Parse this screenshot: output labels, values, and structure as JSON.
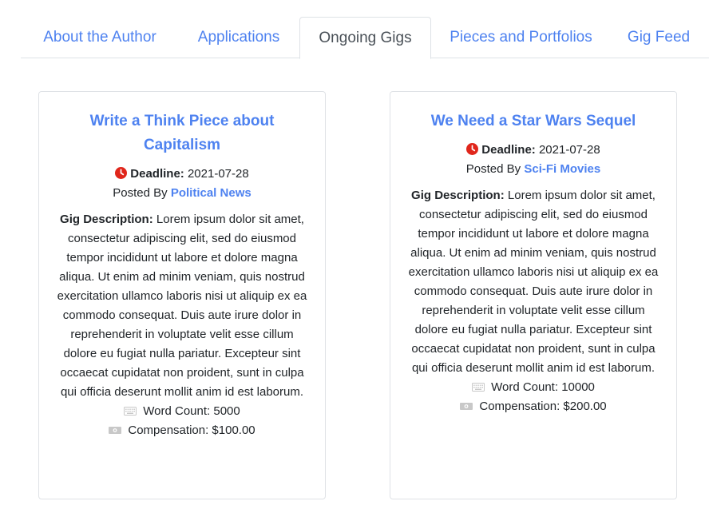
{
  "tabs": [
    {
      "label": "About the Author"
    },
    {
      "label": "Applications"
    },
    {
      "label": "Ongoing Gigs",
      "active": true
    },
    {
      "label": "Pieces and Portfolios"
    },
    {
      "label": "Gig Feed"
    }
  ],
  "gigs": [
    {
      "title": "Write a Think Piece about Capitalism",
      "deadline_label": "Deadline:",
      "deadline": "2021-07-28",
      "posted_by_prefix": "Posted By",
      "posted_by": "Political News",
      "description_label": "Gig Description:",
      "description": "Lorem ipsum dolor sit amet, consectetur adipiscing elit, sed do eiusmod tempor incididunt ut labore et dolore magna aliqua. Ut enim ad minim veniam, quis nostrud exercitation ullamco laboris nisi ut aliquip ex ea commodo consequat. Duis aute irure dolor in reprehenderit in voluptate velit esse cillum dolore eu fugiat nulla pariatur. Excepteur sint occaecat cupidatat non proident, sunt in culpa qui officia deserunt mollit anim id est laborum.",
      "word_count": "Word Count: 5000",
      "compensation": "Compensation: $100.00"
    },
    {
      "title": "We Need a Star Wars Sequel",
      "deadline_label": "Deadline:",
      "deadline": "2021-07-28",
      "posted_by_prefix": "Posted By",
      "posted_by": "Sci-Fi Movies",
      "description_label": "Gig Description:",
      "description": "Lorem ipsum dolor sit amet, consectetur adipiscing elit, sed do eiusmod tempor incididunt ut labore et dolore magna aliqua. Ut enim ad minim veniam, quis nostrud exercitation ullamco laboris nisi ut aliquip ex ea commodo consequat. Duis aute irure dolor in reprehenderit in voluptate velit esse cillum dolore eu fugiat nulla pariatur. Excepteur sint occaecat cupidatat non proident, sunt in culpa qui officia deserunt mollit anim id est laborum.",
      "word_count": "Word Count: 10000",
      "compensation": "Compensation: $200.00"
    }
  ],
  "colors": {
    "link": "#4e82f0",
    "active_tab_text": "#495057",
    "deadline_icon": "#e0261b",
    "border": "#dee2e6"
  },
  "icons": {
    "deadline": "clock-icon",
    "word_count": "keyboard-icon",
    "compensation": "cash-icon"
  }
}
